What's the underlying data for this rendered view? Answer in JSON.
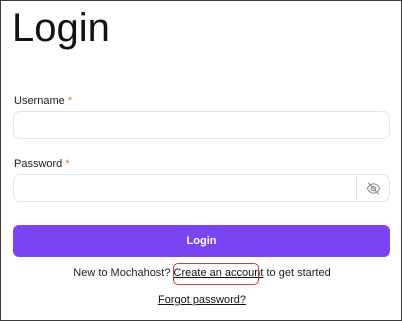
{
  "title": "Login",
  "username": {
    "label": "Username",
    "required_mark": "*",
    "value": ""
  },
  "password": {
    "label": "Password",
    "required_mark": "*",
    "value": "",
    "toggle_icon": "eye-off-icon"
  },
  "login_button": "Login",
  "signup": {
    "prefix": "New to Mochahost?",
    "link": "Create an account",
    "suffix": "to get started"
  },
  "forgot_link": "Forgot password?",
  "colors": {
    "accent": "#7b44f2",
    "required": "#e0762a",
    "highlight": "#d23b3b"
  }
}
